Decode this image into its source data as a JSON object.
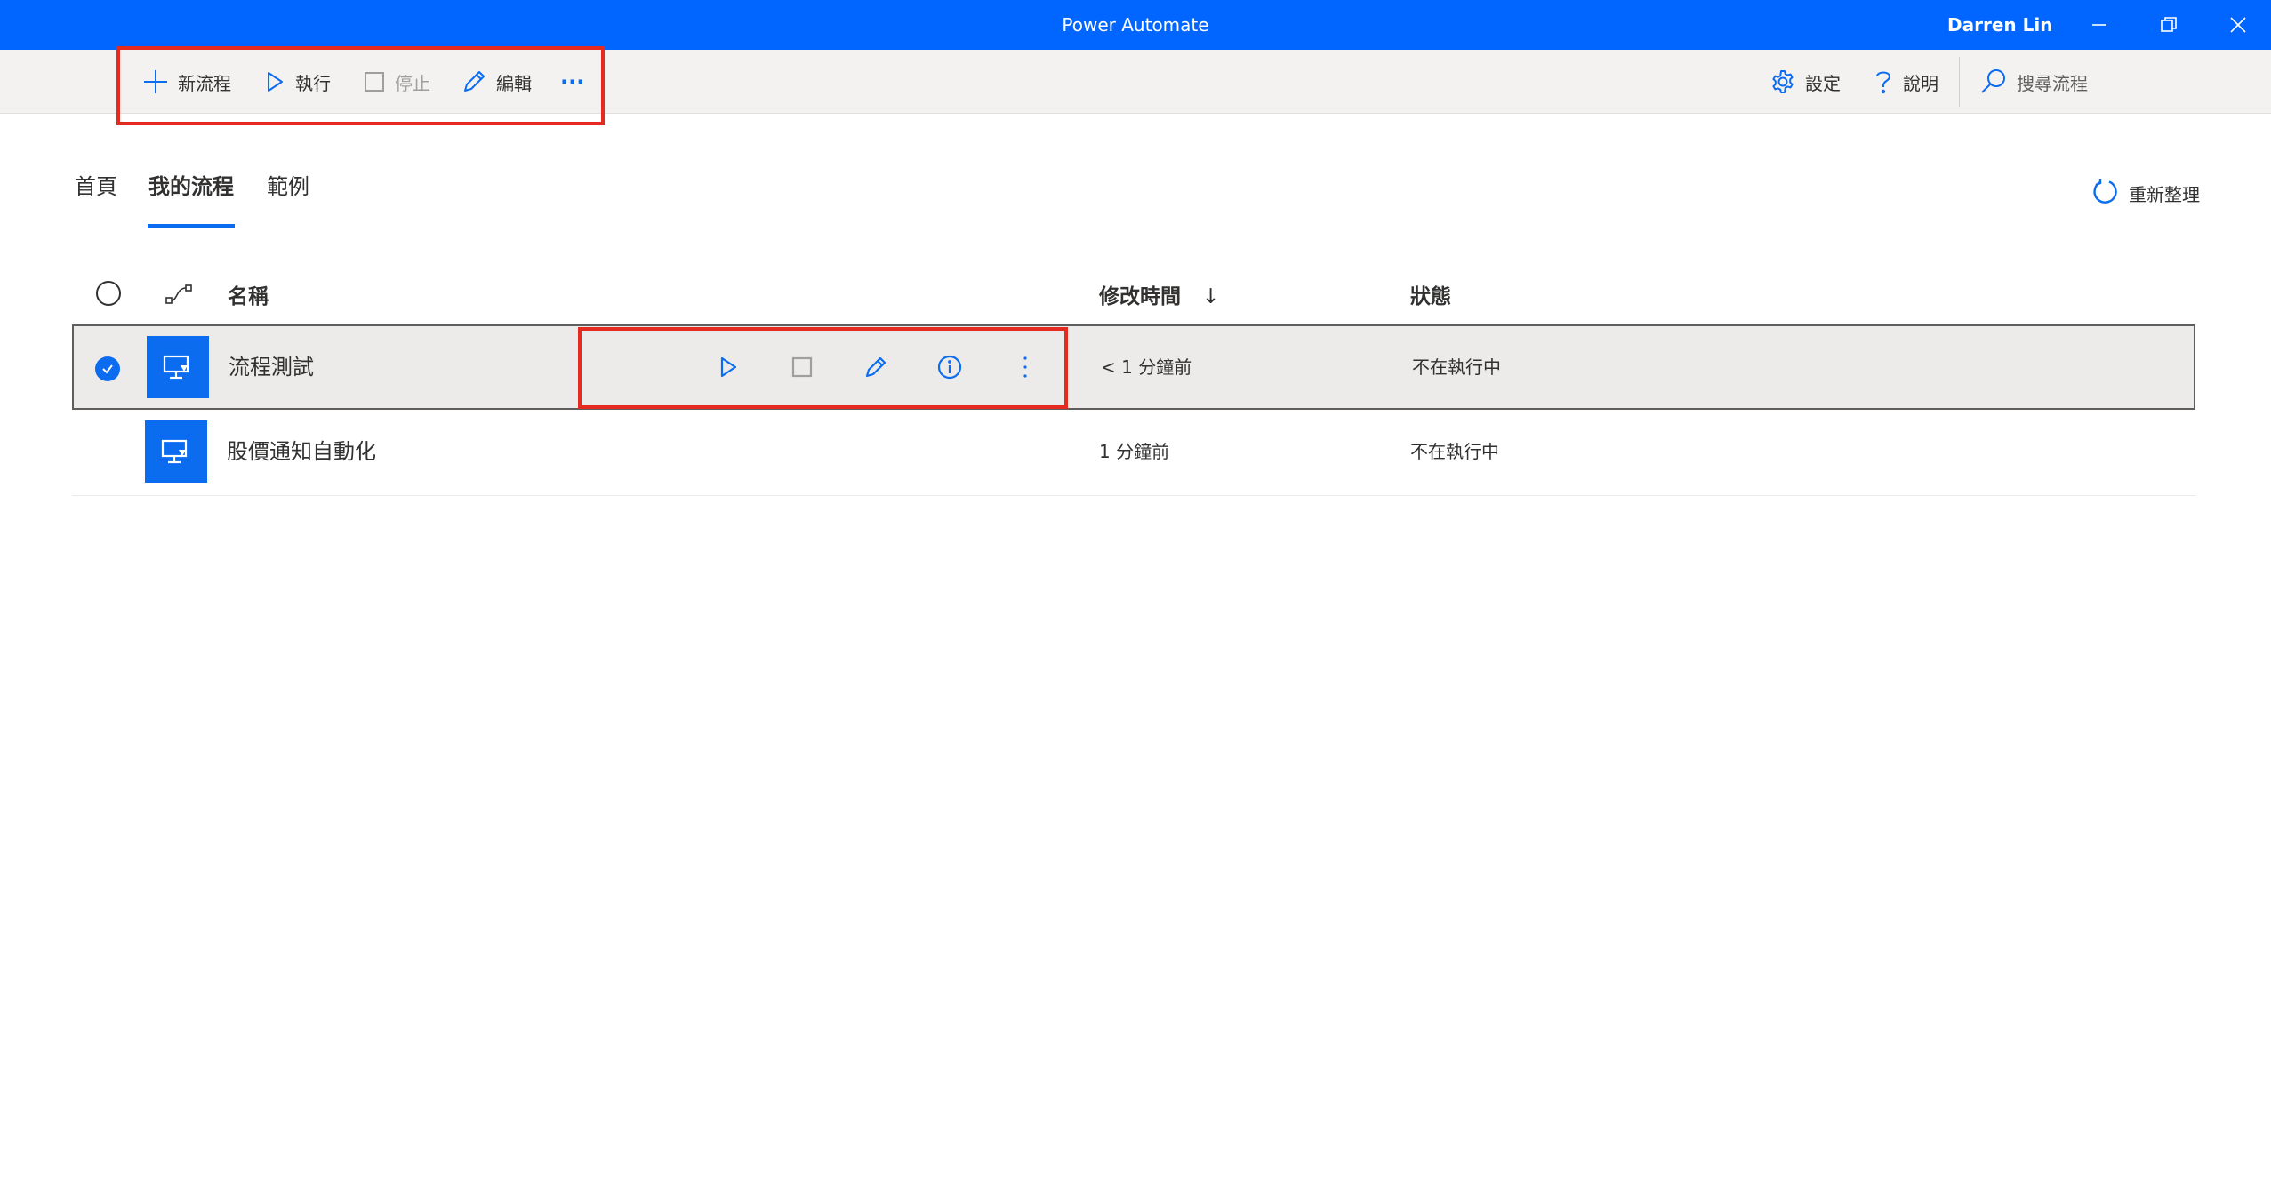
{
  "window": {
    "title": "Power Automate",
    "user_name": "Darren Lin",
    "controls": [
      "minimize-icon",
      "restore-icon",
      "close-icon"
    ]
  },
  "toolbar": {
    "new_flow_label": "新流程",
    "run_label": "執行",
    "stop_label": "停止",
    "edit_label": "編輯",
    "more_label": "···",
    "settings_label": "設定",
    "help_label": "說明",
    "search_placeholder": "搜尋流程"
  },
  "tabs": [
    {
      "label": "首頁",
      "active": false
    },
    {
      "label": "我的流程",
      "active": true
    },
    {
      "label": "範例",
      "active": false
    }
  ],
  "refresh_label": "重新整理",
  "table": {
    "columns": {
      "name": "名稱",
      "modified": "修改時間",
      "modified_sort": "↓",
      "status": "狀態"
    },
    "rows": [
      {
        "name": "流程測試",
        "modified": "< 1 分鐘前",
        "status": "不在執行中",
        "selected": true
      },
      {
        "name": "股價通知自動化",
        "modified": "1 分鐘前",
        "status": "不在執行中",
        "selected": false
      }
    ]
  },
  "colors": {
    "accent": "#0b6cf0",
    "titlebar": "#0066ff",
    "highlight_box": "#e52b20",
    "selected_row": "#edebe9"
  }
}
